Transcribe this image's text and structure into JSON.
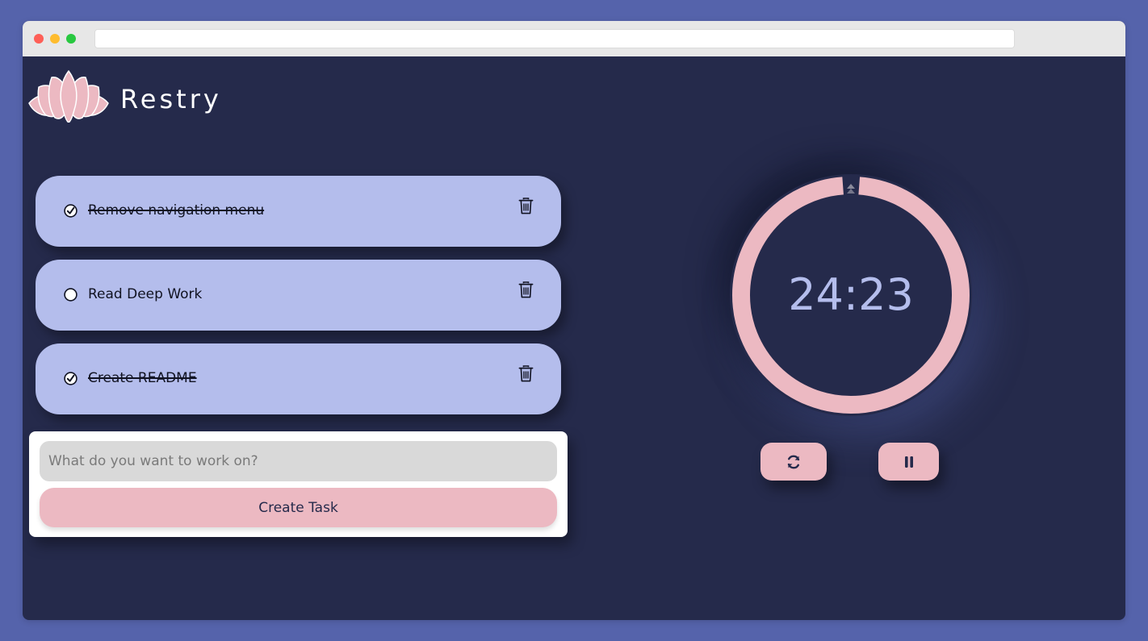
{
  "window": {
    "url": ""
  },
  "brand": {
    "name": "Restry",
    "logo_icon": "lotus-icon",
    "accent": "#ecb9c2"
  },
  "tasks": [
    {
      "title": "Remove navigation menu",
      "completed": true
    },
    {
      "title": "Read Deep Work",
      "completed": false
    },
    {
      "title": "Create README",
      "completed": true
    }
  ],
  "form": {
    "placeholder": "What do you want to work on?",
    "value": "",
    "submit_label": "Create Task"
  },
  "timer": {
    "display": "24:23",
    "remaining_fraction": 0.976
  },
  "controls": {
    "reset_icon": "refresh-icon",
    "pause_icon": "pause-icon"
  },
  "colors": {
    "background": "#252a4b",
    "card": "#b4bdec",
    "accent": "#ecb9c2"
  }
}
